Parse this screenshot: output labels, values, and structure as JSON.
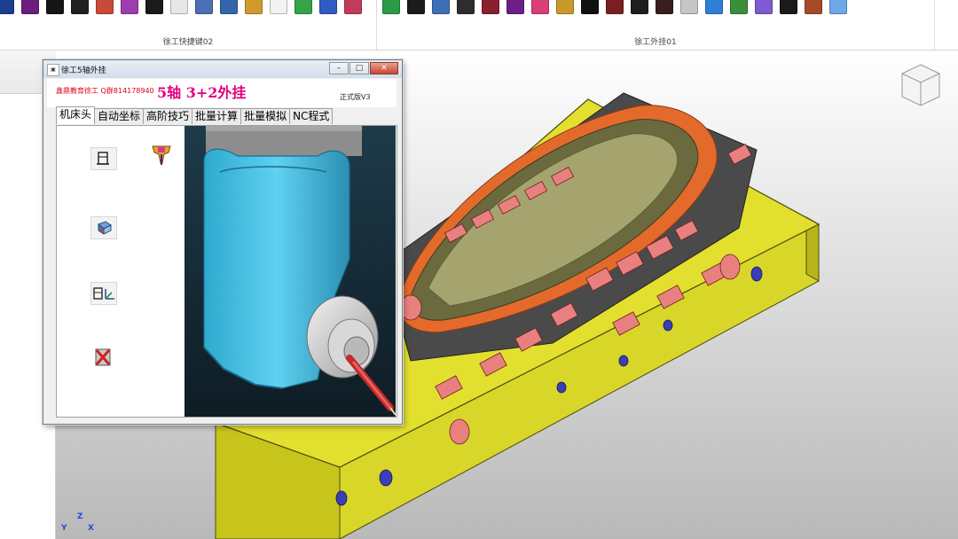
{
  "ribbon": {
    "groups": [
      {
        "label": "徐工快捷键02"
      },
      {
        "label": "徐工外挂01"
      }
    ],
    "left_buttons": [
      {
        "icon": "toolbar-icon",
        "color": "#1c3f8f"
      },
      {
        "icon": "toolbar-icon",
        "color": "#6a1f7d"
      },
      {
        "icon": "toolbar-icon",
        "color": "#151515"
      },
      {
        "icon": "toolbar-icon",
        "color": "#202020"
      },
      {
        "icon": "toolbar-icon",
        "color": "#c84a3a"
      },
      {
        "icon": "toolbar-icon",
        "color": "#9c3db0"
      },
      {
        "icon": "toolbar-icon",
        "color": "#1a1a1a"
      },
      {
        "icon": "toolbar-icon",
        "color": "#e7e7e7"
      },
      {
        "icon": "toolbar-icon",
        "color": "#4d6fb3"
      },
      {
        "icon": "toolbar-icon",
        "color": "#3366aa"
      },
      {
        "icon": "toolbar-icon",
        "color": "#d19a2a"
      },
      {
        "icon": "toolbar-icon",
        "color": "#f2f2f2"
      },
      {
        "icon": "toolbar-icon",
        "color": "#34a34a"
      },
      {
        "icon": "toolbar-icon",
        "color": "#2f5cc4"
      },
      {
        "icon": "toolbar-icon",
        "color": "#c23b5a"
      }
    ],
    "right_buttons": [
      {
        "icon": "toolbar-icon",
        "color": "#2d9a46"
      },
      {
        "icon": "toolbar-icon",
        "color": "#1b1b1b"
      },
      {
        "icon": "toolbar-icon",
        "color": "#3d6fb8"
      },
      {
        "icon": "toolbar-icon",
        "color": "#2d2d2d"
      },
      {
        "icon": "toolbar-icon",
        "color": "#8a1f2e"
      },
      {
        "icon": "toolbar-icon",
        "color": "#6e1f87"
      },
      {
        "icon": "toolbar-icon",
        "color": "#d83e7a"
      },
      {
        "icon": "toolbar-icon",
        "color": "#c99a2b"
      },
      {
        "icon": "toolbar-icon",
        "color": "#111111"
      },
      {
        "icon": "toolbar-icon",
        "color": "#7a1f1f"
      },
      {
        "icon": "toolbar-icon",
        "color": "#1e1e1e"
      },
      {
        "icon": "toolbar-icon",
        "color": "#3a1e1e"
      },
      {
        "icon": "toolbar-icon",
        "color": "#c6c6c6"
      },
      {
        "icon": "toolbar-icon",
        "color": "#2f7fd6"
      },
      {
        "icon": "toolbar-icon",
        "color": "#3a8f3a"
      },
      {
        "icon": "toolbar-icon",
        "color": "#7f5bd1"
      },
      {
        "icon": "toolbar-icon",
        "color": "#1a1a1a"
      },
      {
        "icon": "toolbar-icon",
        "color": "#a84a2a"
      },
      {
        "icon": "toolbar-icon",
        "color": "#6fa8e6"
      }
    ]
  },
  "dialog": {
    "title": "徐工5轴外挂",
    "brand": "鑫鼎教育徐工 Q群814178940",
    "headline": "5轴  3+2外挂",
    "version": "正式版V3",
    "tabs": [
      {
        "label": "机床头",
        "active": true
      },
      {
        "label": "自动坐标",
        "active": false
      },
      {
        "label": "高阶技巧",
        "active": false
      },
      {
        "label": "批量计算",
        "active": false
      },
      {
        "label": "批量模拟",
        "active": false
      },
      {
        "label": "NC程式",
        "active": false
      }
    ],
    "tools": [
      {
        "icon": "machine-head-icon"
      },
      {
        "icon": "spindle-icon"
      },
      {
        "icon": "tool-holder-icon"
      },
      {
        "icon": "axis-setup-icon"
      },
      {
        "icon": "delete-icon"
      }
    ],
    "accent": "#e4007f"
  },
  "viewport": {
    "triad": {
      "x": "X",
      "y": "Y",
      "z": "Z"
    }
  }
}
